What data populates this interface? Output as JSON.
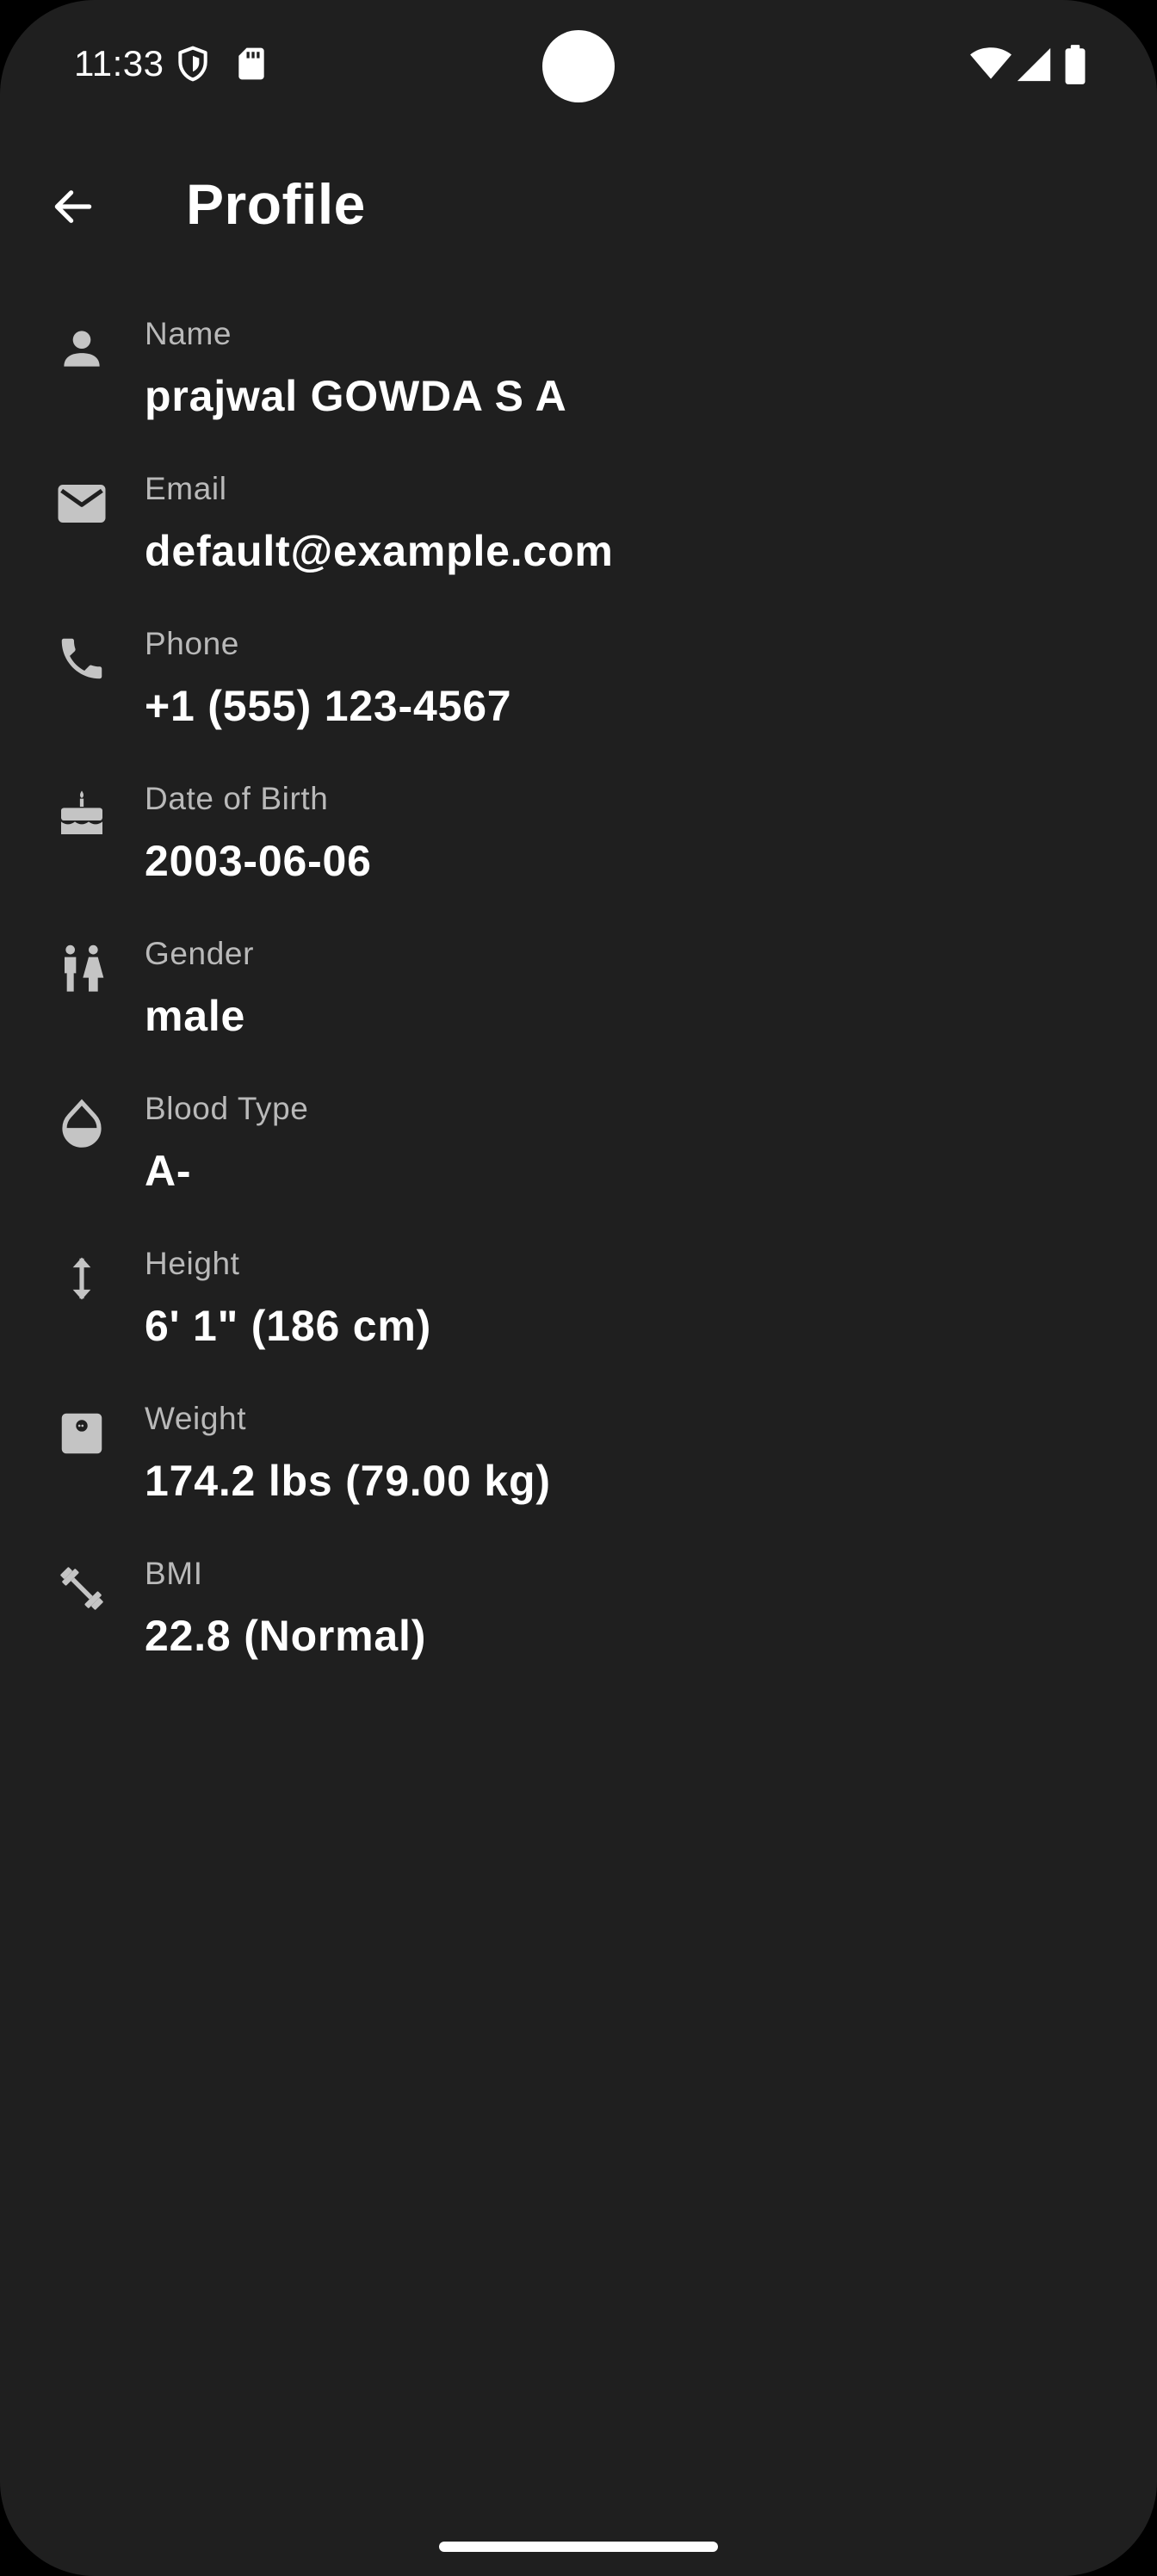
{
  "status_bar": {
    "time": "11:33",
    "icons": [
      "shield-icon",
      "sd-card-icon",
      "wifi-icon",
      "signal-icon",
      "battery-icon"
    ]
  },
  "app_bar": {
    "title": "Profile",
    "back_icon": "arrow-back-icon"
  },
  "profile": {
    "items": [
      {
        "label": "Name",
        "value": "prajwal GOWDA S A",
        "icon": "person-icon"
      },
      {
        "label": "Email",
        "value": "default@example.com",
        "icon": "email-icon"
      },
      {
        "label": "Phone",
        "value": "+1 (555) 123-4567",
        "icon": "phone-icon"
      },
      {
        "label": "Date of Birth",
        "value": "2003-06-06",
        "icon": "cake-icon"
      },
      {
        "label": "Gender",
        "value": "male",
        "icon": "gender-icon"
      },
      {
        "label": "Blood Type",
        "value": "A-",
        "icon": "water-drop-icon"
      },
      {
        "label": "Height",
        "value": "6' 1\" (186 cm)",
        "icon": "height-icon"
      },
      {
        "label": "Weight",
        "value": "174.2 lbs (79.00 kg)",
        "icon": "scale-icon"
      },
      {
        "label": "BMI",
        "value": "22.8 (Normal)",
        "icon": "fitness-icon"
      }
    ]
  },
  "colors": {
    "background": "#1f1f1f",
    "label": "#b9b9b9",
    "value": "#ffffff",
    "icon": "#c4c4c4"
  }
}
